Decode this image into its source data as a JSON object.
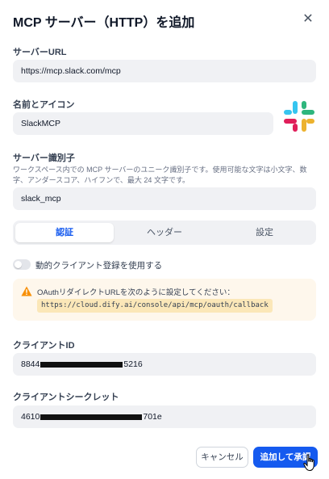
{
  "dialog": {
    "title": "MCP サーバー（HTTP）を追加",
    "close_icon": "close-icon"
  },
  "server_url": {
    "label": "サーバーURL",
    "value": "https://mcp.slack.com/mcp"
  },
  "name_icon": {
    "label": "名前とアイコン",
    "value": "SlackMCP",
    "icon": "slack-logo",
    "colors": [
      "#36c5f0",
      "#2eb67d",
      "#ecb22e",
      "#e01e5a"
    ]
  },
  "server_id": {
    "label": "サーバー識別子",
    "help": "ワークスペース内での MCP サーバーのユニーク識別子です。使用可能な文字は小文字、数字、アンダースコア、ハイフンで、最大 24 文字です。",
    "value": "slack_mcp"
  },
  "tabs": [
    {
      "label": "認証",
      "active": true
    },
    {
      "label": "ヘッダー",
      "active": false
    },
    {
      "label": "設定",
      "active": false
    }
  ],
  "dynamic_client": {
    "label": "動的クライアント登録を使用する",
    "enabled": false
  },
  "warning": {
    "icon": "warning-icon",
    "text": "OAuthリダイレクトURLを次のように設定してください：",
    "url": "https://cloud.dify.ai/console/api/mcp/oauth/callback"
  },
  "client_id": {
    "label": "クライアントID",
    "prefix": "8844",
    "suffix": "5216"
  },
  "client_secret": {
    "label": "クライアントシークレット",
    "prefix": "4610",
    "suffix": "701e"
  },
  "footer": {
    "cancel": "キャンセル",
    "submit": "追加して承認"
  },
  "colors": {
    "accent": "#155aef",
    "warning_bg": "#fef7ec",
    "warning_icon": "#f79009"
  }
}
